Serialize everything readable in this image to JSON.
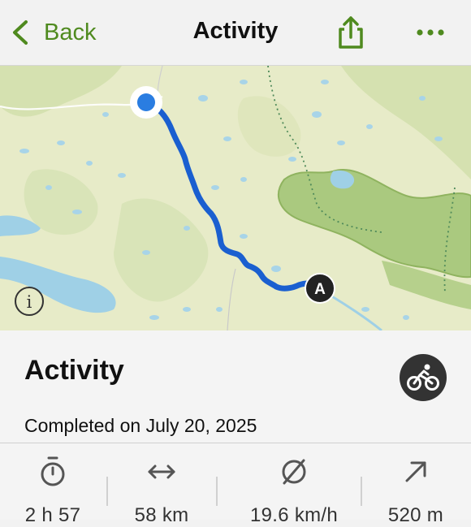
{
  "nav": {
    "back_label": "Back",
    "title": "Activity"
  },
  "icons": {
    "back": "chevron-left-icon",
    "share": "share-icon",
    "more": "ellipsis-icon",
    "info": "info-icon",
    "start_marker": "start-location-dot",
    "end_marker": "end-marker-a",
    "sport": "cycling-icon",
    "duration": "stopwatch-icon",
    "distance": "horizontal-arrows-icon",
    "avg_speed": "average-speed-icon",
    "elevation": "arrow-up-right-icon"
  },
  "map": {
    "end_marker_label": "A",
    "info_label": "i"
  },
  "activity": {
    "title": "Activity",
    "completed": "Completed on July 20, 2025"
  },
  "stats": {
    "duration": "2 h 57",
    "distance": "58 km",
    "avg_speed": "19.6 km/h",
    "elevation": "520 m"
  },
  "colors": {
    "accent": "#4f8a1f",
    "route": "#1a5fd0",
    "map_base": "#e7ebc8",
    "map_water": "#9fd0e6",
    "map_park": "#aac97f",
    "badge": "#333333"
  }
}
